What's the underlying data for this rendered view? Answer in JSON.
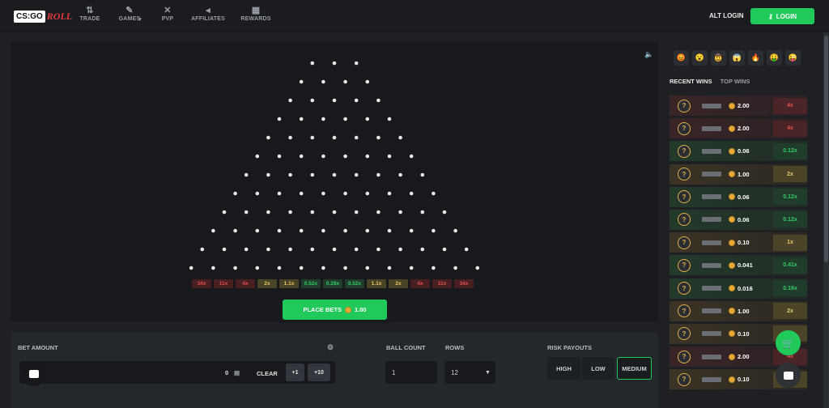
{
  "logo": {
    "cs": "CS:GO",
    "roll": "ROLL"
  },
  "nav": [
    {
      "label": "TRADE",
      "icon": "⇅",
      "icon_name": "trade-icon"
    },
    {
      "label": "GAMES",
      "icon": "✎",
      "icon_name": "games-icon",
      "caret": "▾"
    },
    {
      "label": "PVP",
      "icon": "✕",
      "icon_name": "swords-icon"
    },
    {
      "label": "AFFILIATES",
      "icon": "◂",
      "icon_name": "megaphone-icon"
    },
    {
      "label": "REWARDS",
      "icon": "▦",
      "icon_name": "gift-icon"
    }
  ],
  "header": {
    "alt_login": "ALT LOGIN",
    "login": "LOGIN",
    "login_icon": "key-icon"
  },
  "board": {
    "rows": 12,
    "multipliers": [
      {
        "v": "34x",
        "c": "red"
      },
      {
        "v": "11x",
        "c": "red"
      },
      {
        "v": "4x",
        "c": "red"
      },
      {
        "v": "2x",
        "c": "gold"
      },
      {
        "v": "1.1x",
        "c": "gold"
      },
      {
        "v": "0.52x",
        "c": "green"
      },
      {
        "v": "0.28x",
        "c": "green"
      },
      {
        "v": "0.52x",
        "c": "green"
      },
      {
        "v": "1.1x",
        "c": "gold"
      },
      {
        "v": "2x",
        "c": "gold"
      },
      {
        "v": "4x",
        "c": "red"
      },
      {
        "v": "11x",
        "c": "red"
      },
      {
        "v": "34x",
        "c": "red"
      }
    ]
  },
  "place": {
    "label": "PLACE BETS",
    "amount": "1.00"
  },
  "controls": {
    "bet_amount_label": "BET AMOUNT",
    "bet_value": "0",
    "clear": "CLEAR",
    "plus1": "+1",
    "plus10": "+10",
    "ball_count_label": "BALL COUNT",
    "ball_count": "1",
    "rows_label": "ROWS",
    "rows_value": "12",
    "risk_label": "RISK PAYOUTS",
    "risk": [
      "HIGH",
      "LOW",
      "MEDIUM"
    ],
    "risk_selected": "MEDIUM"
  },
  "side": {
    "tabs": {
      "recent": "RECENT WINS",
      "top": "TOP WINS"
    },
    "emojis": [
      "😡",
      "😮",
      "🤠",
      "😱",
      "🔥",
      "🤑",
      "😜"
    ],
    "wins": [
      {
        "amount": "2.00",
        "mult": "4x",
        "c": "red"
      },
      {
        "amount": "2.00",
        "mult": "4x",
        "c": "red"
      },
      {
        "amount": "0.06",
        "mult": "0.12x",
        "c": "green"
      },
      {
        "amount": "1.00",
        "mult": "2x",
        "c": "gold"
      },
      {
        "amount": "0.06",
        "mult": "0.12x",
        "c": "green"
      },
      {
        "amount": "0.06",
        "mult": "0.12x",
        "c": "green"
      },
      {
        "amount": "0.10",
        "mult": "1x",
        "c": "gold"
      },
      {
        "amount": "0.041",
        "mult": "0.41x",
        "c": "green"
      },
      {
        "amount": "0.016",
        "mult": "0.16x",
        "c": "green"
      },
      {
        "amount": "1.00",
        "mult": "2x",
        "c": "gold"
      },
      {
        "amount": "0.10",
        "mult": "1x",
        "c": "gold"
      },
      {
        "amount": "2.00",
        "mult": "4x",
        "c": "red"
      },
      {
        "amount": "0.10",
        "mult": "1x",
        "c": "gold"
      }
    ]
  },
  "colors": {
    "accent": "#1fc95a",
    "red": "#e05050",
    "gold": "#e6c76a",
    "green": "#35c96a"
  }
}
